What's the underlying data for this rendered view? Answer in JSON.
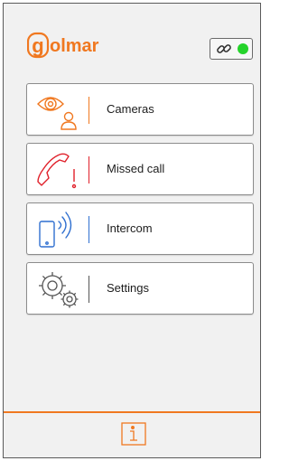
{
  "header": {
    "logo_text": "golmar",
    "link_icon": "chain-link-icon",
    "connection_status": "connected",
    "colors": {
      "brand": "#f07820",
      "status": "#25d32b"
    }
  },
  "menu": {
    "items": [
      {
        "label": "Cameras",
        "icon": "eye-person-icon",
        "accent": "#f07820"
      },
      {
        "label": "Missed call",
        "icon": "handset-exclamation-icon",
        "accent": "#e0202a"
      },
      {
        "label": "Intercom",
        "icon": "phone-signal-icon",
        "accent": "#2f6fd0"
      },
      {
        "label": "Settings",
        "icon": "gears-icon",
        "accent": "#555555"
      }
    ]
  },
  "footer": {
    "info_icon": "info-icon",
    "accent": "#f07820"
  }
}
